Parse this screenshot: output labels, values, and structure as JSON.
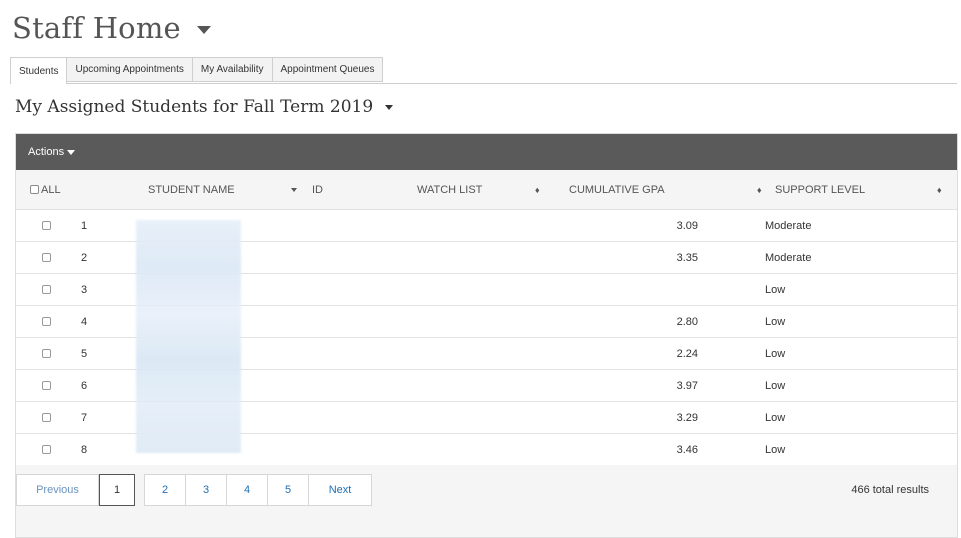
{
  "header": {
    "title": "Staff Home"
  },
  "tabs": [
    {
      "label": "Students",
      "active": true
    },
    {
      "label": "Upcoming Appointments",
      "active": false
    },
    {
      "label": "My Availability",
      "active": false
    },
    {
      "label": "Appointment Queues",
      "active": false
    }
  ],
  "section": {
    "title": "My Assigned Students for Fall Term 2019"
  },
  "table": {
    "actions_label": "Actions",
    "columns": {
      "all": "ALL",
      "student_name": "STUDENT NAME",
      "id": "ID",
      "watch_list": "WATCH LIST",
      "gpa": "CUMULATIVE GPA",
      "support": "SUPPORT LEVEL"
    },
    "sort_symbol": "♦",
    "rows": [
      {
        "num": "1",
        "gpa": "3.09",
        "support": "Moderate"
      },
      {
        "num": "2",
        "gpa": "3.35",
        "support": "Moderate"
      },
      {
        "num": "3",
        "gpa": "",
        "support": "Low"
      },
      {
        "num": "4",
        "gpa": "2.80",
        "support": "Low"
      },
      {
        "num": "5",
        "gpa": "2.24",
        "support": "Low"
      },
      {
        "num": "6",
        "gpa": "3.97",
        "support": "Low"
      },
      {
        "num": "7",
        "gpa": "3.29",
        "support": "Low"
      },
      {
        "num": "8",
        "gpa": "3.46",
        "support": "Low"
      }
    ]
  },
  "pagination": {
    "previous": "Previous",
    "pages": [
      "1",
      "2",
      "3",
      "4",
      "5"
    ],
    "current": "1",
    "next": "Next",
    "total": "466 total results"
  },
  "colors": {
    "accent_link": "#1f6fb5",
    "toolbar_bg": "#5a5a5a"
  }
}
